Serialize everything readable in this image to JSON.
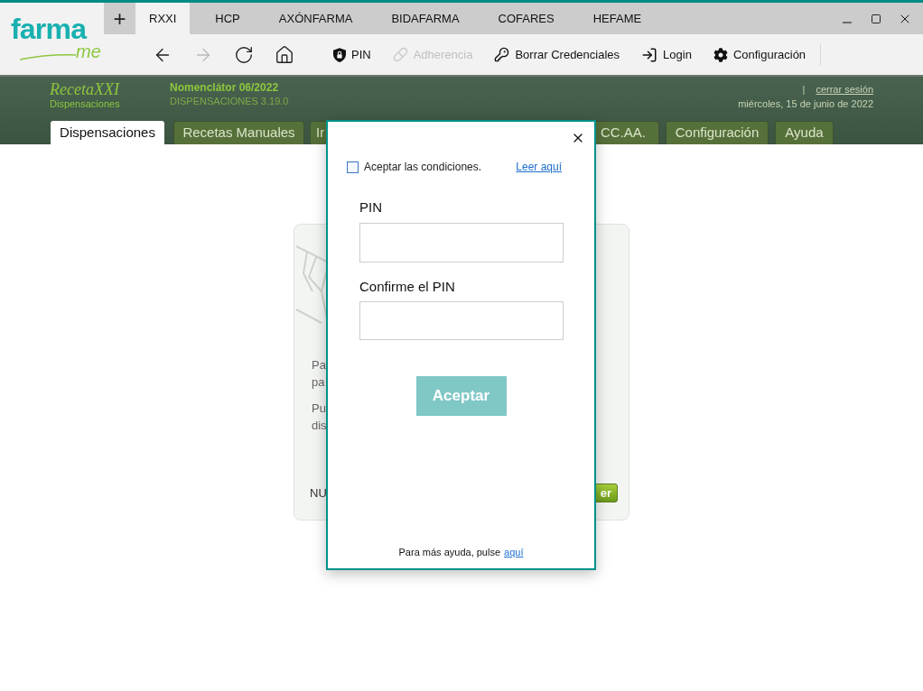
{
  "logo": {
    "main": "farma",
    "sub": "me"
  },
  "browser_tabs": [
    {
      "label": "RXXI",
      "selected": true
    },
    {
      "label": "HCP",
      "selected": false
    },
    {
      "label": "AXÓNFARMA",
      "selected": false
    },
    {
      "label": "BIDAFARMA",
      "selected": false
    },
    {
      "label": "COFARES",
      "selected": false
    },
    {
      "label": "HEFAME",
      "selected": false
    }
  ],
  "new_tab": {
    "label": "+"
  },
  "nav_buttons": [
    {
      "kind": "back",
      "disabled": false
    },
    {
      "kind": "forward",
      "disabled": true
    },
    {
      "kind": "reload",
      "disabled": false
    },
    {
      "kind": "home",
      "disabled": false
    }
  ],
  "toolbar_actions": [
    {
      "kind": "pin",
      "label": "PIN",
      "disabled": false
    },
    {
      "kind": "pill",
      "label": "Adherencia",
      "disabled": true
    },
    {
      "kind": "key",
      "label": "Borrar Credenciales",
      "disabled": false
    },
    {
      "kind": "login",
      "label": "Login",
      "disabled": false
    },
    {
      "kind": "gear",
      "label": "Configuración",
      "disabled": false
    }
  ],
  "header": {
    "brand": "RecetaXXI",
    "brand_sub": "Dispensaciones",
    "nomenclator": "Nomenclátor 06/2022",
    "version": "DISPENSACIONES 3.19.0",
    "separator": "|",
    "logout": "cerrar sesión",
    "date": "miércoles, 15 de junio de 2022"
  },
  "app_tabs": [
    {
      "label": "Dispensaciones",
      "selected": true
    },
    {
      "label": "Recetas Manuales",
      "selected": false
    },
    {
      "label": "Ir",
      "selected": false
    },
    {
      "label": "CC.AA.",
      "selected": false
    },
    {
      "label": "Configuración",
      "selected": false
    },
    {
      "label": "Ayuda",
      "selected": false
    }
  ],
  "card": {
    "lines": [
      "Pa",
      "pa",
      "Pu",
      "dis"
    ],
    "footer_text": "NU",
    "button": "er"
  },
  "dialog": {
    "checkbox": {
      "label": "Aceptar las condiciones.",
      "checked": false
    },
    "terms_link": "Leer aquí",
    "pin_label": "PIN",
    "confirm_label": "Confirme el PIN",
    "submit": "Aceptar",
    "help_text": "Para más ayuda, pulse",
    "help_link": "aquí"
  }
}
